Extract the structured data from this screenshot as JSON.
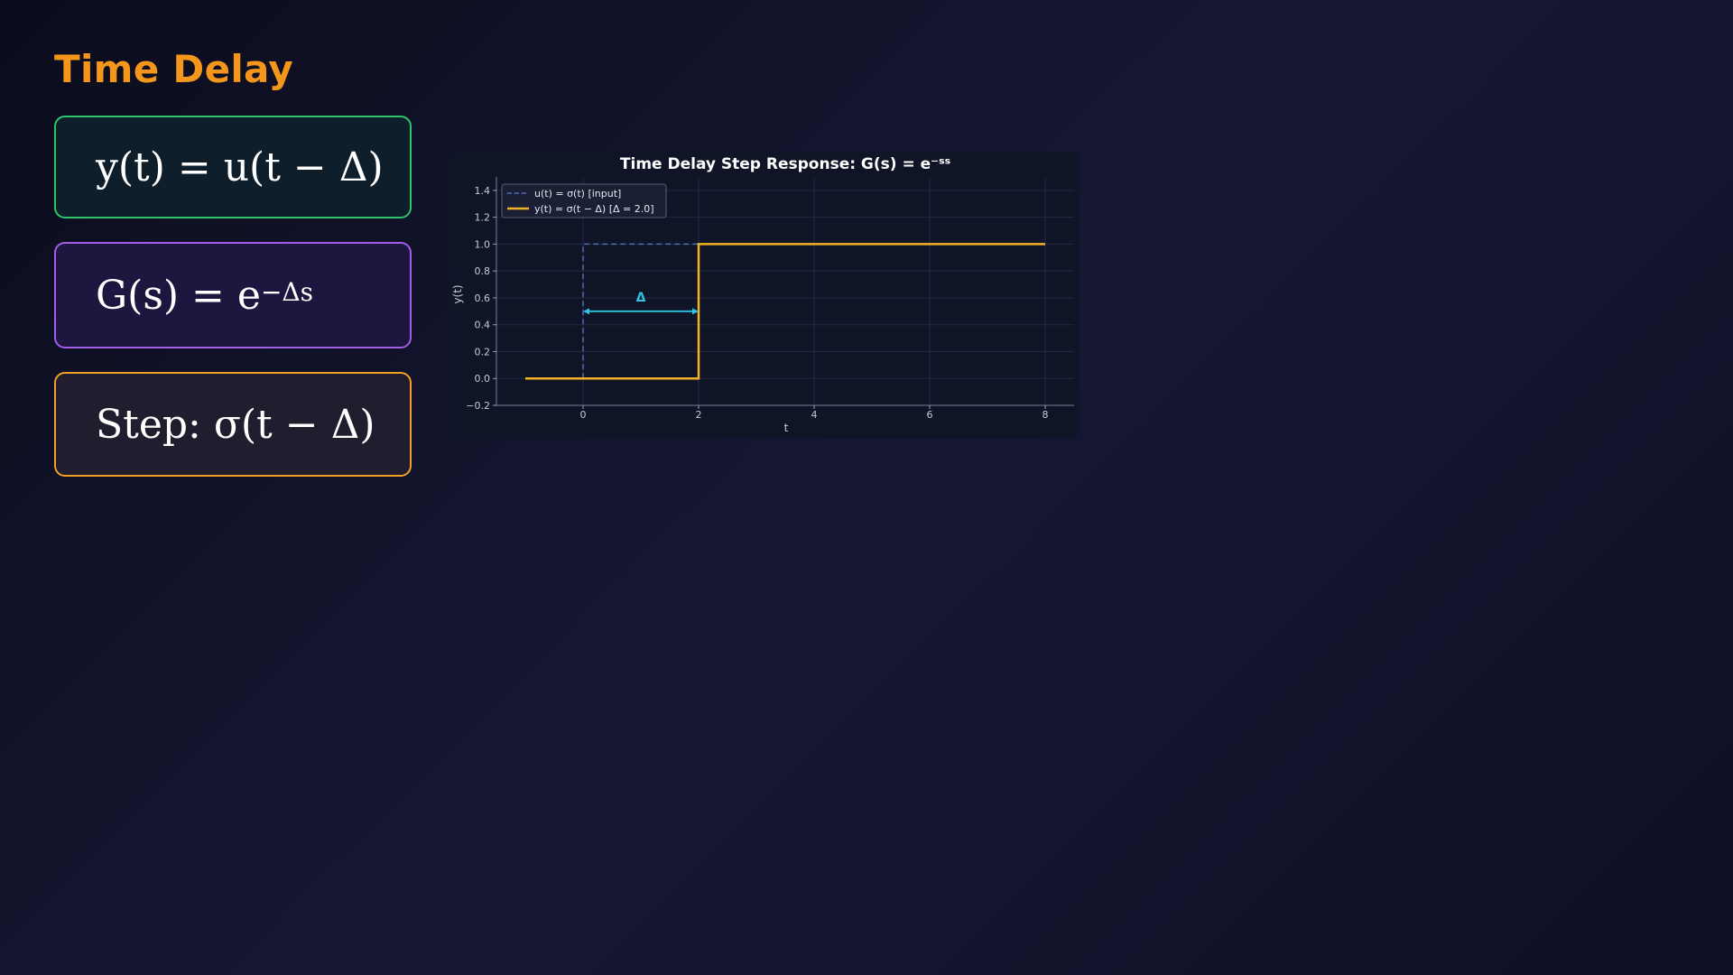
{
  "page": {
    "title": "Time Delay"
  },
  "cards": [
    {
      "formula_main": "y(t) = u(t − Δ)",
      "formula_sup": ""
    },
    {
      "formula_main": "G(s) = e",
      "formula_sup": "−Δs"
    },
    {
      "formula_main": "Step: σ(t − Δ)",
      "formula_sup": ""
    }
  ],
  "colors": {
    "accent": "#f5961c",
    "card1_border": "#2ec46a",
    "card2_border": "#a15ee8",
    "card3_border": "#f2a024",
    "input_series": "#4a6fb5",
    "output_series": "#f2b324",
    "annotation": "#2fc4e0"
  },
  "chart_data": {
    "type": "line",
    "title": "Time Delay Step Response:  G(s) = e⁻ˢˢ",
    "xlabel": "t",
    "ylabel": "y(t)",
    "xlim": [
      -1.5,
      8.5
    ],
    "ylim": [
      -0.2,
      1.5
    ],
    "xticks": [
      0,
      2,
      4,
      6,
      8
    ],
    "xtick_labels": [
      "0",
      "2",
      "4",
      "6",
      "8"
    ],
    "yticks": [
      -0.2,
      0.0,
      0.2,
      0.4,
      0.6,
      0.8,
      1.0,
      1.2,
      1.4
    ],
    "ytick_labels": [
      "−0.2",
      "0.0",
      "0.2",
      "0.4",
      "0.6",
      "0.8",
      "1.0",
      "1.2",
      "1.4"
    ],
    "grid": true,
    "legend_position": "top-left",
    "series": [
      {
        "name": "u(t) = σ(t)  [input]",
        "style": "dashed",
        "x": [
          0,
          0,
          2
        ],
        "y": [
          0,
          1,
          1
        ]
      },
      {
        "name": "y(t) = σ(t − Δ)  [Δ = 2.0]",
        "style": "solid",
        "x": [
          -1,
          2,
          2,
          8
        ],
        "y": [
          0,
          0,
          1,
          1
        ]
      }
    ],
    "annotation": {
      "text": "Δ",
      "x_start": 0,
      "x_end": 2,
      "y": 0.5
    }
  }
}
